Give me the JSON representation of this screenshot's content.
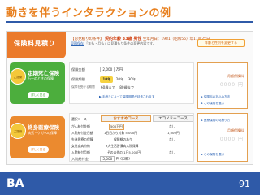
{
  "slide": {
    "title": "動きを伴うインタラクションの例",
    "page_number": "91",
    "logo": "BA"
  },
  "brand": {
    "title": "保険料見積り"
  },
  "plan": {
    "line_prefix": "【お見積りの条件】",
    "age": "契約年齢 33歳 男性",
    "line_suffix": "生年月日：1981（昭和56）年11月25日",
    "sub_link": "見積保存",
    "sub_text": "「年払・月払」は見積もり条件の変更内容です。"
  },
  "top_button": "年齢と性別を変更する",
  "cards": [
    {
      "stamp": "ご提案",
      "title": "定期死亡保険",
      "sub": "万一のときの保障",
      "pill": "詳しく見る"
    },
    {
      "stamp": "ご提案",
      "title": "終身医療保険",
      "sub": "病気・ケガへの保障",
      "pill": "詳しく見る"
    }
  ],
  "death": {
    "rows": [
      {
        "label": "保険金額",
        "value": "2,000",
        "unit": "万円"
      },
      {
        "label": "保険期間",
        "sublabel": "保障を受ける期間"
      }
    ],
    "period_selected": "10年",
    "period_options": [
      "20年",
      "30年"
    ],
    "age_options": [
      "60歳まで",
      "80歳まで"
    ],
    "note": "▶ 手続きによって保険期間が延長されます"
  },
  "medical": {
    "course_main": "おすすめコース",
    "course_eco": "エコノミーコース",
    "rows": [
      {
        "label": "選択コース",
        "main": "",
        "eco": ""
      },
      {
        "label": "がん給付金額",
        "main": "500万円",
        "eco": "なし"
      },
      {
        "label": "入院給付金日額",
        "main": "1日目から対象 5,000円",
        "eco": "1,000円"
      },
      {
        "label": "先進医療の保障",
        "main": "保障額のあり",
        "eco": "なし"
      },
      {
        "label": "女性疾病特約",
        "main": "3大生活習慣病入院保障",
        "eco": ""
      },
      {
        "label": "入院給付月額",
        "main": "その以外の 1日5,000円",
        "eco": "なし"
      }
    ],
    "premium_label": "入院給付金",
    "premium_value": "5,000",
    "premium_unit": "円",
    "premium_suffix": "(日額)"
  },
  "right": [
    {
      "label": "月額保険料",
      "value": "0000 円",
      "q1": "▶ 保険料の払込み方法",
      "q2": "▶ この保険を選ぶ"
    },
    {
      "label": "月額保険料",
      "value": "0000 円",
      "q1": "▶ 医療保険の見積り方",
      "q2": "▶ この保険を選ぶ"
    }
  ]
}
